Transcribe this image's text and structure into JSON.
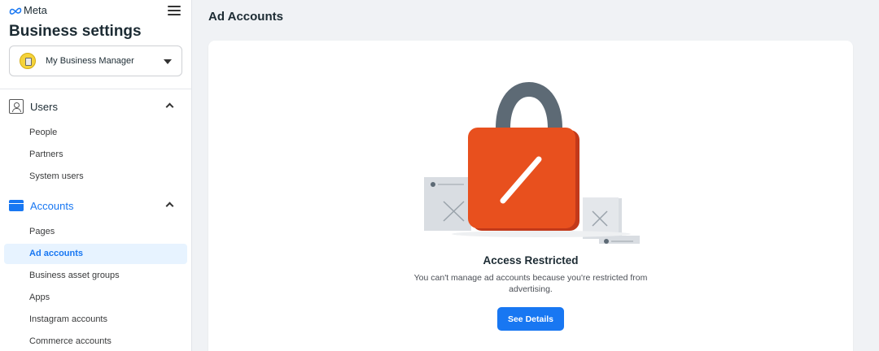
{
  "brand": {
    "name": "Meta",
    "icon": "meta-logo-icon"
  },
  "sidebar": {
    "title": "Business settings",
    "business_selector": {
      "value": "My Business Manager",
      "icon": "business-avatar-icon"
    },
    "sections": [
      {
        "label": "Users",
        "icon": "users-icon",
        "expanded": true,
        "items": [
          {
            "label": "People"
          },
          {
            "label": "Partners"
          },
          {
            "label": "System users"
          }
        ]
      },
      {
        "label": "Accounts",
        "icon": "accounts-icon",
        "expanded": true,
        "active": true,
        "items": [
          {
            "label": "Pages"
          },
          {
            "label": "Ad accounts",
            "active": true
          },
          {
            "label": "Business asset groups"
          },
          {
            "label": "Apps"
          },
          {
            "label": "Instagram accounts"
          },
          {
            "label": "Commerce accounts"
          }
        ]
      }
    ]
  },
  "main": {
    "page_title": "Ad Accounts",
    "restricted": {
      "title": "Access Restricted",
      "message": "You can't manage ad accounts because you're restricted from advertising.",
      "button_label": "See Details",
      "illustration": "padlock-illustration"
    }
  },
  "colors": {
    "accent": "#1877f2",
    "active_bg": "#e7f3ff",
    "lock_body": "#e8501e",
    "lock_shackle": "#5d6a75"
  }
}
